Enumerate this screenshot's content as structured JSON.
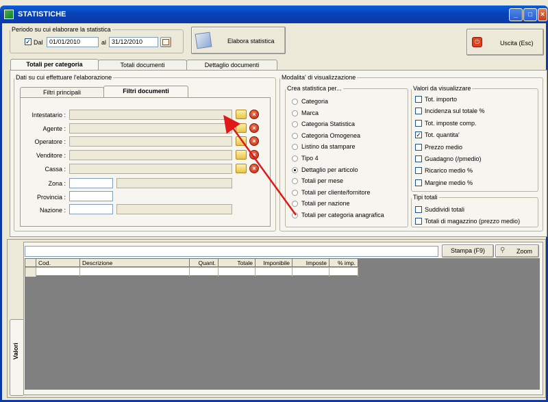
{
  "window": {
    "title": "STATISTICHE",
    "minimize": "_",
    "maximize": "□",
    "close": "×"
  },
  "period": {
    "legend": "Periodo su cui elaborare la statistica",
    "dal_label": "Dal",
    "dal_checked": true,
    "dal_value": "01/01/2010",
    "al_label": "al",
    "al_value": "31/12/2010"
  },
  "elabora_label": "Elabora statistica",
  "uscita_label": "Uscita (Esc)",
  "main_tabs": [
    "Totali per categoria",
    "Totali documenti",
    "Dettaglio documenti"
  ],
  "dati": {
    "legend": "Dati su cui effettuare l'elaborazione",
    "sub_tabs": [
      "Filtri principali",
      "Filtri documenti"
    ],
    "fields": [
      "Intestatario :",
      "Agente :",
      "Operatore :",
      "Venditore :",
      "Cassa :",
      "Zona :",
      "Provincia :",
      "Nazione :"
    ]
  },
  "modalita": {
    "legend": "Modalita' di visualizzazione",
    "crea_legend": "Crea statistica per...",
    "options": [
      "Categoria",
      "Marca",
      "Categoria Statistica",
      "Categoria Omogenea",
      "Listino da stampare",
      "Tipo 4",
      "Dettaglio per articolo",
      "Totali per mese",
      "Totali per cliente/fornitore",
      "Totali per nazione",
      "Totali per categoria anagrafica"
    ],
    "selected_index": 6,
    "valori_legend": "Valori da visualizzare",
    "valori": [
      {
        "label": "Tot. importo",
        "checked": false
      },
      {
        "label": "Incidenza sul totale %",
        "checked": false
      },
      {
        "label": "Tot. imposte comp.",
        "checked": false
      },
      {
        "label": "Tot. quantita'",
        "checked": true
      },
      {
        "label": "Prezzo medio",
        "checked": false
      },
      {
        "label": "Guadagno (/pmedio)",
        "checked": false
      },
      {
        "label": "Ricarico medio %",
        "checked": false
      },
      {
        "label": "Margine medio %",
        "checked": false
      }
    ],
    "tipi_legend": "Tipi totali",
    "tipi": [
      {
        "label": "Suddividi totali",
        "checked": false
      },
      {
        "label": "Totali di magazzino (prezzo medio)",
        "checked": false
      }
    ]
  },
  "bottom": {
    "stampa_label": "Stampa (F9)",
    "zoom_label": "Zoom",
    "side_tab": "Valori",
    "columns": [
      "Cod.",
      "Descrizione",
      "Quant.",
      "Totale",
      "Imponibile",
      "Imposte",
      "% imp."
    ]
  },
  "colors": {
    "titlebar": "#0842b8",
    "arrow": "#e01818",
    "grid_bg": "#808080"
  }
}
